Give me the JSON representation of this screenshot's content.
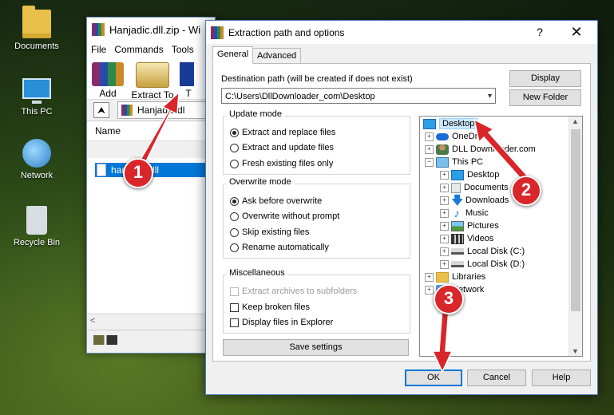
{
  "desktop": {
    "icons": [
      {
        "label": "Documents",
        "icon": "folder-icon"
      },
      {
        "label": "This PC",
        "icon": "computer-icon"
      },
      {
        "label": "Network",
        "icon": "network-icon"
      },
      {
        "label": "Recycle Bin",
        "icon": "recycle-bin-icon"
      }
    ]
  },
  "winrar": {
    "title": "Hanjadic.dll.zip - Wi",
    "menu": [
      "File",
      "Commands",
      "Tools"
    ],
    "toolbar": {
      "add": "Add",
      "extract_to": "Extract To",
      "test": "T"
    },
    "path": "Hanjadic.dl",
    "list_header_name": "Name",
    "file_name": "hanjadic.dll"
  },
  "dialog": {
    "title": "Extraction path and options",
    "help": "?",
    "close": "✕",
    "tabs": [
      "General",
      "Advanced"
    ],
    "dest_label": "Destination path (will be created if does not exist)",
    "dest_value": "C:\\Users\\DllDownloader_com\\Desktop",
    "display_btn": "Display",
    "new_folder_btn": "New Folder",
    "update_mode": {
      "title": "Update mode",
      "options": [
        "Extract and replace files",
        "Extract and update files",
        "Fresh existing files only"
      ],
      "selected": 0
    },
    "overwrite_mode": {
      "title": "Overwrite mode",
      "options": [
        "Ask before overwrite",
        "Overwrite without prompt",
        "Skip existing files",
        "Rename automatically"
      ],
      "selected": 0
    },
    "misc": {
      "title": "Miscellaneous",
      "options": [
        "Extract archives to subfolders",
        "Keep broken files",
        "Display files in Explorer"
      ]
    },
    "save_settings": "Save settings",
    "tree": [
      "Desktop",
      "OneDrive",
      "DLL Downloader.com",
      "This PC",
      "Desktop",
      "Documents",
      "Downloads",
      "Music",
      "Pictures",
      "Videos",
      "Local Disk (C:)",
      "Local Disk (D:)",
      "Libraries",
      "Network"
    ],
    "ok": "OK",
    "cancel": "Cancel",
    "help_btn": "Help"
  },
  "annotations": [
    "1",
    "2",
    "3"
  ],
  "colors": {
    "annotation": "#d8262a",
    "selection": "#0078d7"
  }
}
